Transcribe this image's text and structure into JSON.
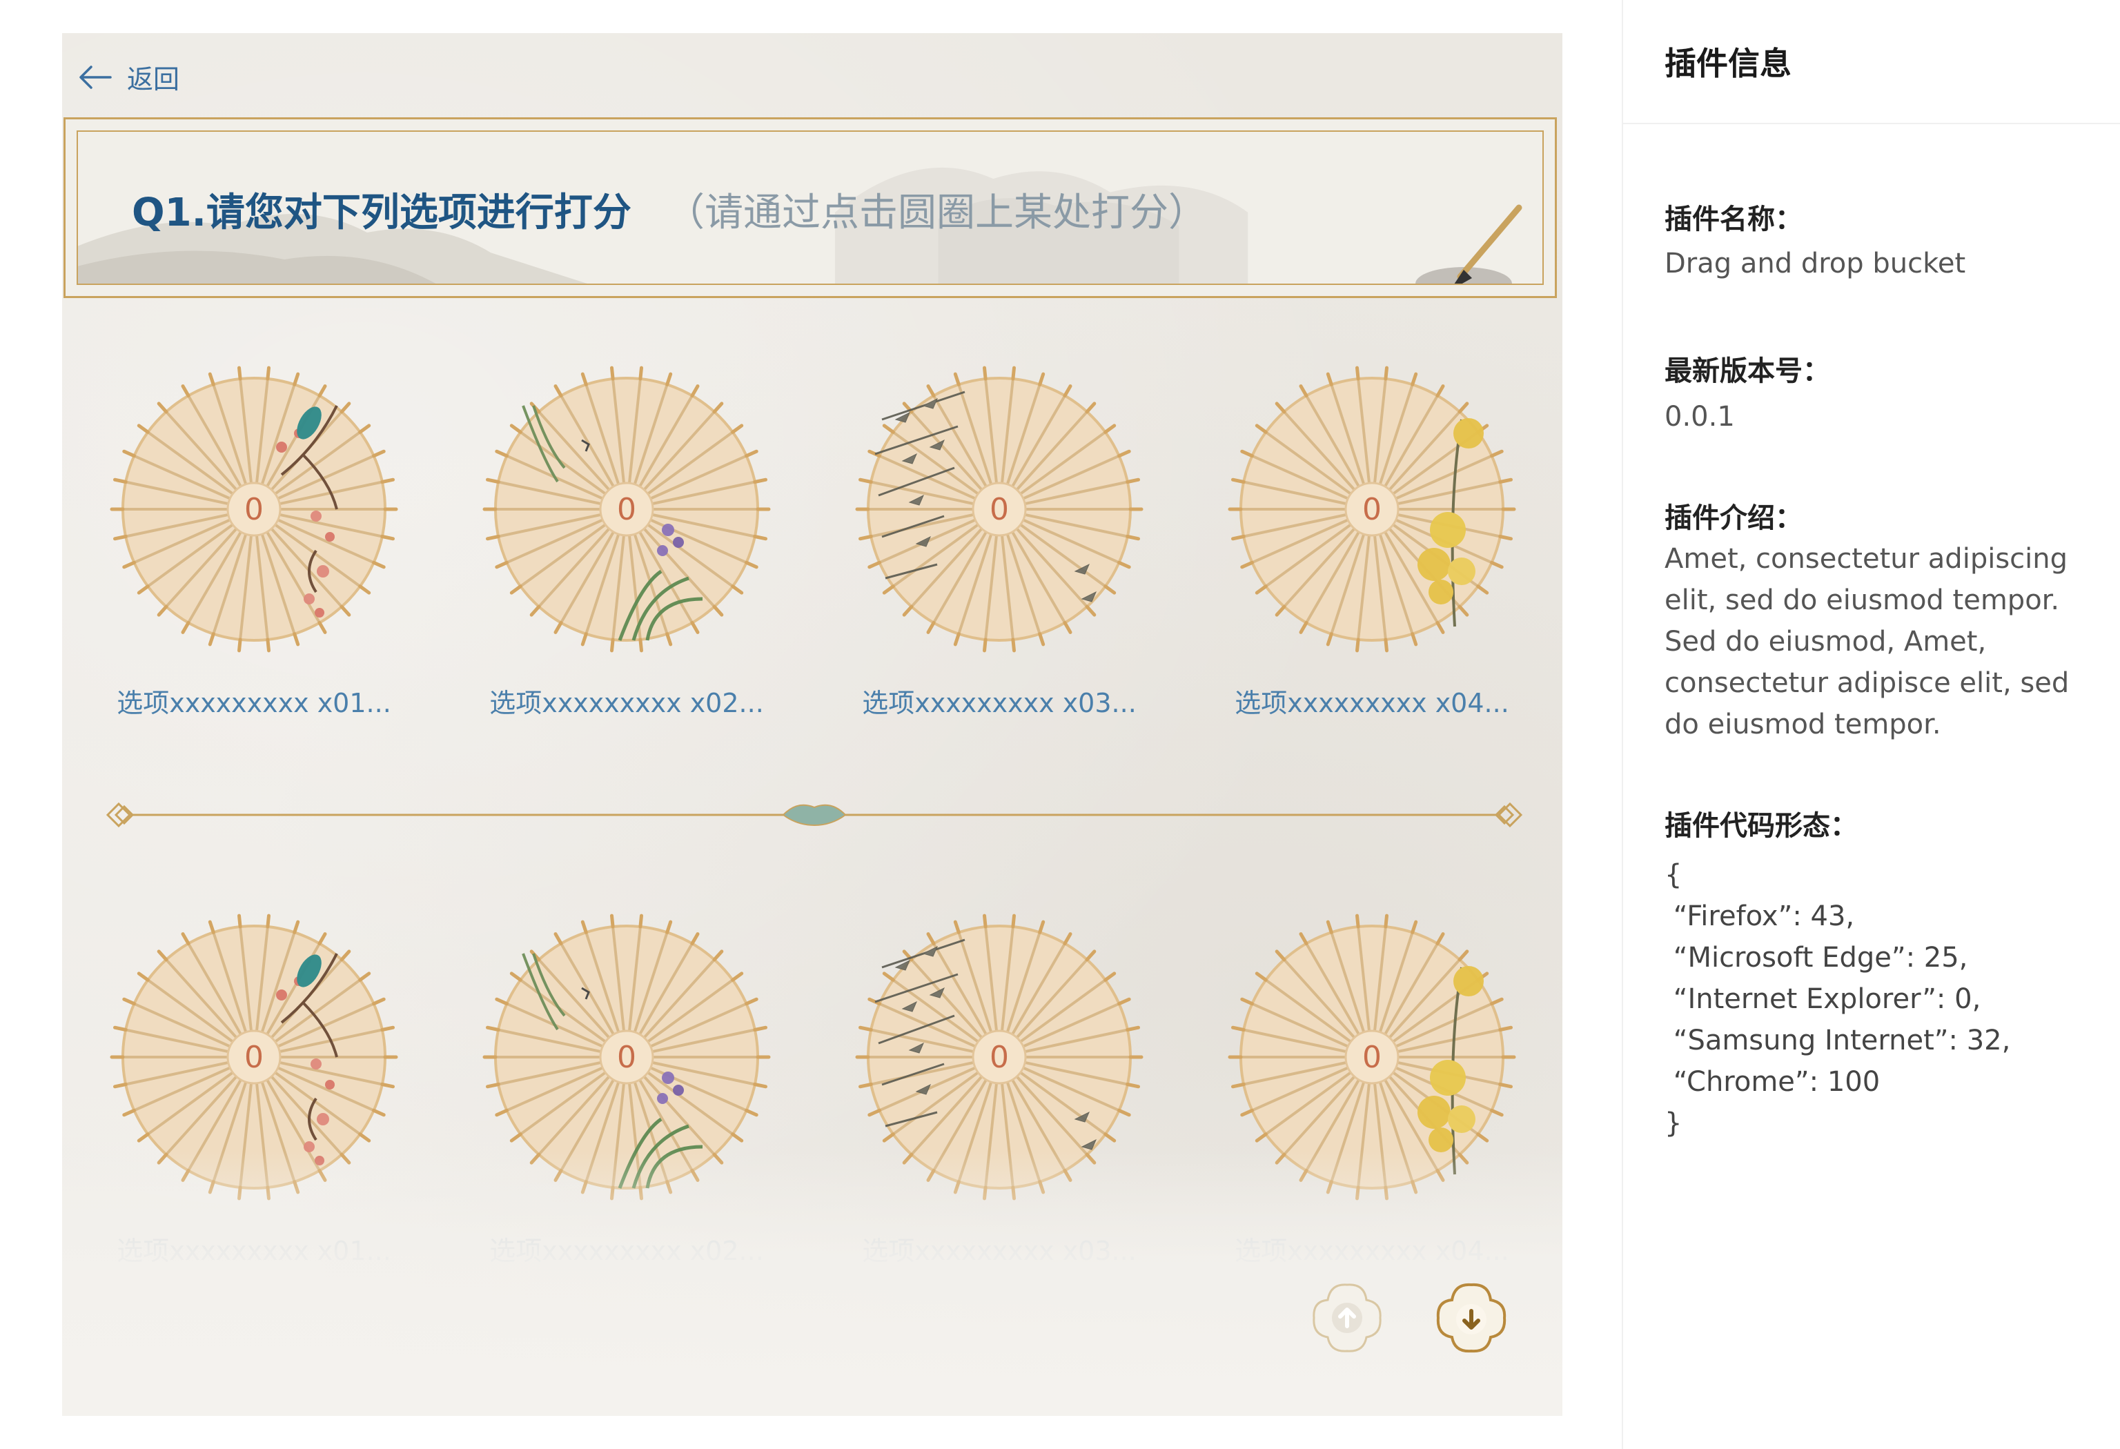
{
  "nav": {
    "back_label": "返回"
  },
  "question": {
    "title": "Q1.请您对下列选项进行打分",
    "hint": "（请通过点击圆圈上某处打分）"
  },
  "rows": [
    {
      "items": [
        {
          "score": "0",
          "label": "选项xxxxxxxxx x01...",
          "motif": "bird-plum"
        },
        {
          "score": "0",
          "label": "选项xxxxxxxxx x02...",
          "motif": "orchid"
        },
        {
          "score": "0",
          "label": "选项xxxxxxxxx x03...",
          "motif": "bamboo"
        },
        {
          "score": "0",
          "label": "选项xxxxxxxxx x04...",
          "motif": "chrysanthemum"
        }
      ]
    },
    {
      "items": [
        {
          "score": "0",
          "label": "选项xxxxxxxxx x01...",
          "motif": "bird-plum"
        },
        {
          "score": "0",
          "label": "选项xxxxxxxxx x02...",
          "motif": "orchid"
        },
        {
          "score": "0",
          "label": "选项xxxxxxxxx x03...",
          "motif": "bamboo"
        },
        {
          "score": "0",
          "label": "选项xxxxxxxxx x04...",
          "motif": "chrysanthemum"
        }
      ]
    }
  ],
  "pager": {
    "up_icon": "arrow-up-icon",
    "down_icon": "arrow-down-icon"
  },
  "colors": {
    "title_blue": "#1f5583",
    "label_blue": "#4a7fab",
    "gold_border": "#c9a35e",
    "umbrella_fill": "#f0dcc0",
    "score_red": "#c76d4a"
  },
  "panel": {
    "title": "插件信息",
    "name_label": "插件名称：",
    "name_value": "Drag and drop bucket",
    "version_label": "最新版本号：",
    "version_value": "0.0.1",
    "intro_label": "插件介绍：",
    "intro_value": "Amet, consectetur adipiscing elit, sed do eiusmod tempor. Sed do eiusmod, Amet, consectetur adipisce elit, sed do eiusmod tempor.",
    "code_label": "插件代码形态：",
    "code_lines": [
      "{",
      " “Firefox”: 43,",
      " “Microsoft Edge”: 25,",
      " “Internet Explorer”: 0,",
      " “Samsung Internet”: 32,",
      " “Chrome”: 100",
      "}"
    ]
  }
}
